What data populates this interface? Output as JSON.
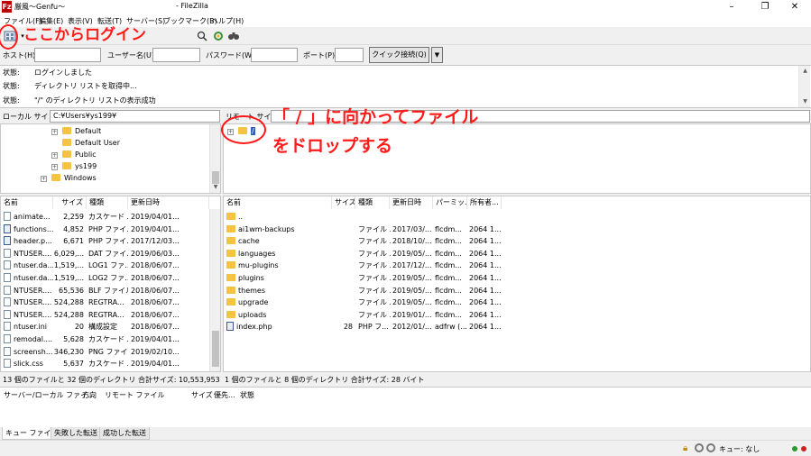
{
  "window": {
    "title_left": "厳風〜Genfu〜",
    "title_right": "- FileZilla",
    "app_icon": "Fz",
    "minimize_glyph": "–",
    "maximize_glyph": "❐",
    "close_glyph": "✕"
  },
  "menu": [
    "ファイル(F)",
    "編集(E)",
    "表示(V)",
    "転送(T)",
    "サーバー(S)",
    "ブックマーク(B)",
    "ヘルプ(H)"
  ],
  "toolbar": {
    "icons": [
      "site-manager-icon",
      "search-icon",
      "reconnect-icon",
      "binoculars-icon"
    ]
  },
  "quickconnect": {
    "host_label": "ホスト(H):",
    "user_label": "ユーザー名(U):",
    "pass_label": "パスワード(W):",
    "port_label": "ポート(P):",
    "button_label": "クイック接続(Q)",
    "dropdown_glyph": "▼"
  },
  "log": [
    {
      "key": "状態:",
      "msg": "ログインしました"
    },
    {
      "key": "状態:",
      "msg": "ディレクトリ リストを取得中..."
    },
    {
      "key": "状態:",
      "msg": "\"/\" のディレクトリ リストの表示成功"
    }
  ],
  "local": {
    "path_label": "ローカル サイト:",
    "path": "C:¥Users¥ys199¥",
    "tree": [
      "Default",
      "Default User",
      "Public",
      "ys199",
      "Windows"
    ],
    "headers": [
      "名前",
      "サイズ",
      "種類",
      "更新日時"
    ],
    "files": [
      {
        "name": "animate...",
        "size": "2,259",
        "type": "カスケード ...",
        "date": "2019/04/01..."
      },
      {
        "name": "functions...",
        "size": "4,852",
        "type": "PHP ファイ...",
        "date": "2019/04/01..."
      },
      {
        "name": "header.p...",
        "size": "6,671",
        "type": "PHP ファイ...",
        "date": "2017/12/03..."
      },
      {
        "name": "NTUSER....",
        "size": "6,029,...",
        "type": "DAT ファイル",
        "date": "2019/06/03..."
      },
      {
        "name": "ntuser.da...",
        "size": "1,519,...",
        "type": "LOG1 ファ...",
        "date": "2018/06/07..."
      },
      {
        "name": "ntuser.da...",
        "size": "1,519,...",
        "type": "LOG2 ファ...",
        "date": "2018/06/07..."
      },
      {
        "name": "NTUSER....",
        "size": "65,536",
        "type": "BLF ファイル",
        "date": "2018/06/07..."
      },
      {
        "name": "NTUSER....",
        "size": "524,288",
        "type": "REGTRA...",
        "date": "2018/06/07..."
      },
      {
        "name": "NTUSER....",
        "size": "524,288",
        "type": "REGTRA...",
        "date": "2018/06/07..."
      },
      {
        "name": "ntuser.ini",
        "size": "20",
        "type": "構成設定",
        "date": "2018/06/07..."
      },
      {
        "name": "remodal....",
        "size": "5,628",
        "type": "カスケード ...",
        "date": "2019/04/01..."
      },
      {
        "name": "screensh...",
        "size": "346,230",
        "type": "PNG ファイ...",
        "date": "2019/02/10..."
      },
      {
        "name": "slick.css",
        "size": "5,637",
        "type": "カスケード ...",
        "date": "2019/04/01..."
      }
    ],
    "summary": "13 個のファイルと 32 個のディレクトリ 合計サイズ: 10,553,953 バイト"
  },
  "remote": {
    "path_label": "リモート サイト:",
    "path": "",
    "tree_root": "/",
    "headers": [
      "名前",
      "サイズ",
      "種類",
      "更新日時",
      "パーミッ...",
      "所有者..."
    ],
    "files": [
      {
        "name": "..",
        "size": "",
        "type": "",
        "date": "",
        "perm": "",
        "owner": ""
      },
      {
        "name": "ai1wm-backups",
        "size": "",
        "type": "ファイル ...",
        "date": "2017/03/...",
        "perm": "flcdm...",
        "owner": "2064 1..."
      },
      {
        "name": "cache",
        "size": "",
        "type": "ファイル ...",
        "date": "2018/10/...",
        "perm": "flcdm...",
        "owner": "2064 1..."
      },
      {
        "name": "languages",
        "size": "",
        "type": "ファイル ...",
        "date": "2019/05/...",
        "perm": "flcdm...",
        "owner": "2064 1..."
      },
      {
        "name": "mu-plugins",
        "size": "",
        "type": "ファイル ...",
        "date": "2017/12/...",
        "perm": "flcdm...",
        "owner": "2064 1..."
      },
      {
        "name": "plugins",
        "size": "",
        "type": "ファイル ...",
        "date": "2019/05/...",
        "perm": "flcdm...",
        "owner": "2064 1..."
      },
      {
        "name": "themes",
        "size": "",
        "type": "ファイル ...",
        "date": "2019/05/...",
        "perm": "flcdm...",
        "owner": "2064 1..."
      },
      {
        "name": "upgrade",
        "size": "",
        "type": "ファイル ...",
        "date": "2019/05/...",
        "perm": "flcdm...",
        "owner": "2064 1..."
      },
      {
        "name": "uploads",
        "size": "",
        "type": "ファイル ...",
        "date": "2019/01/...",
        "perm": "flcdm...",
        "owner": "2064 1..."
      },
      {
        "name": "index.php",
        "size": "28",
        "type": "PHP フ...",
        "date": "2012/01/...",
        "perm": "adfrw (...",
        "owner": "2064 1..."
      }
    ],
    "summary": "1 個のファイルと 8 個のディレクトリ 合計サイズ: 28 バイト"
  },
  "queue": {
    "headers": [
      "サーバー/ローカル ファイ...",
      "方向",
      "リモート ファイル",
      "サイズ",
      "優先...",
      "状態"
    ]
  },
  "tabs": [
    "キュー ファイル",
    "失敗した転送",
    "成功した転送"
  ],
  "statusbar": {
    "queue": "キュー: なし"
  },
  "annotations": {
    "login": "ここからログイン",
    "drop_line1": "「 / 」に向かってファイル",
    "drop_line2": "をドロップする",
    "color": "#ff1a1a"
  }
}
